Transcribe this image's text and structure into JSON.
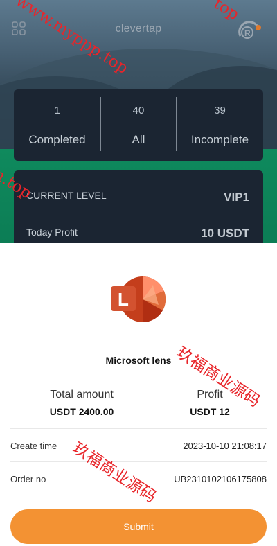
{
  "header": {
    "brand": "clevertap"
  },
  "stats": [
    {
      "count": "1",
      "label": "Completed"
    },
    {
      "count": "40",
      "label": "All"
    },
    {
      "count": "39",
      "label": "Incomplete"
    }
  ],
  "level_card": {
    "current_level_label": "CURRENT LEVEL",
    "current_level_value": "VIP1",
    "today_profit_label": "Today Profit",
    "today_profit_value": "10 USDT"
  },
  "order": {
    "app_name": "Microsoft lens",
    "total_amount_label": "Total amount",
    "total_amount_value": "USDT 2400.00",
    "profit_label": "Profit",
    "profit_value": "USDT 12",
    "create_time_label": "Create time",
    "create_time_value": "2023-10-10 21:08:17",
    "order_no_label": "Order no",
    "order_no_value": "UB2310102106175808",
    "submit_label": "Submit"
  },
  "watermarks": {
    "url_1": "www.myppp.top",
    "url_2": "top",
    "url_3": "n.top",
    "cn_1": "玖福商业源码",
    "cn_2": "玖福商业源码"
  },
  "colors": {
    "accent": "#f39233",
    "watermark": "#e8252a",
    "card_bg": "#1b2532"
  }
}
